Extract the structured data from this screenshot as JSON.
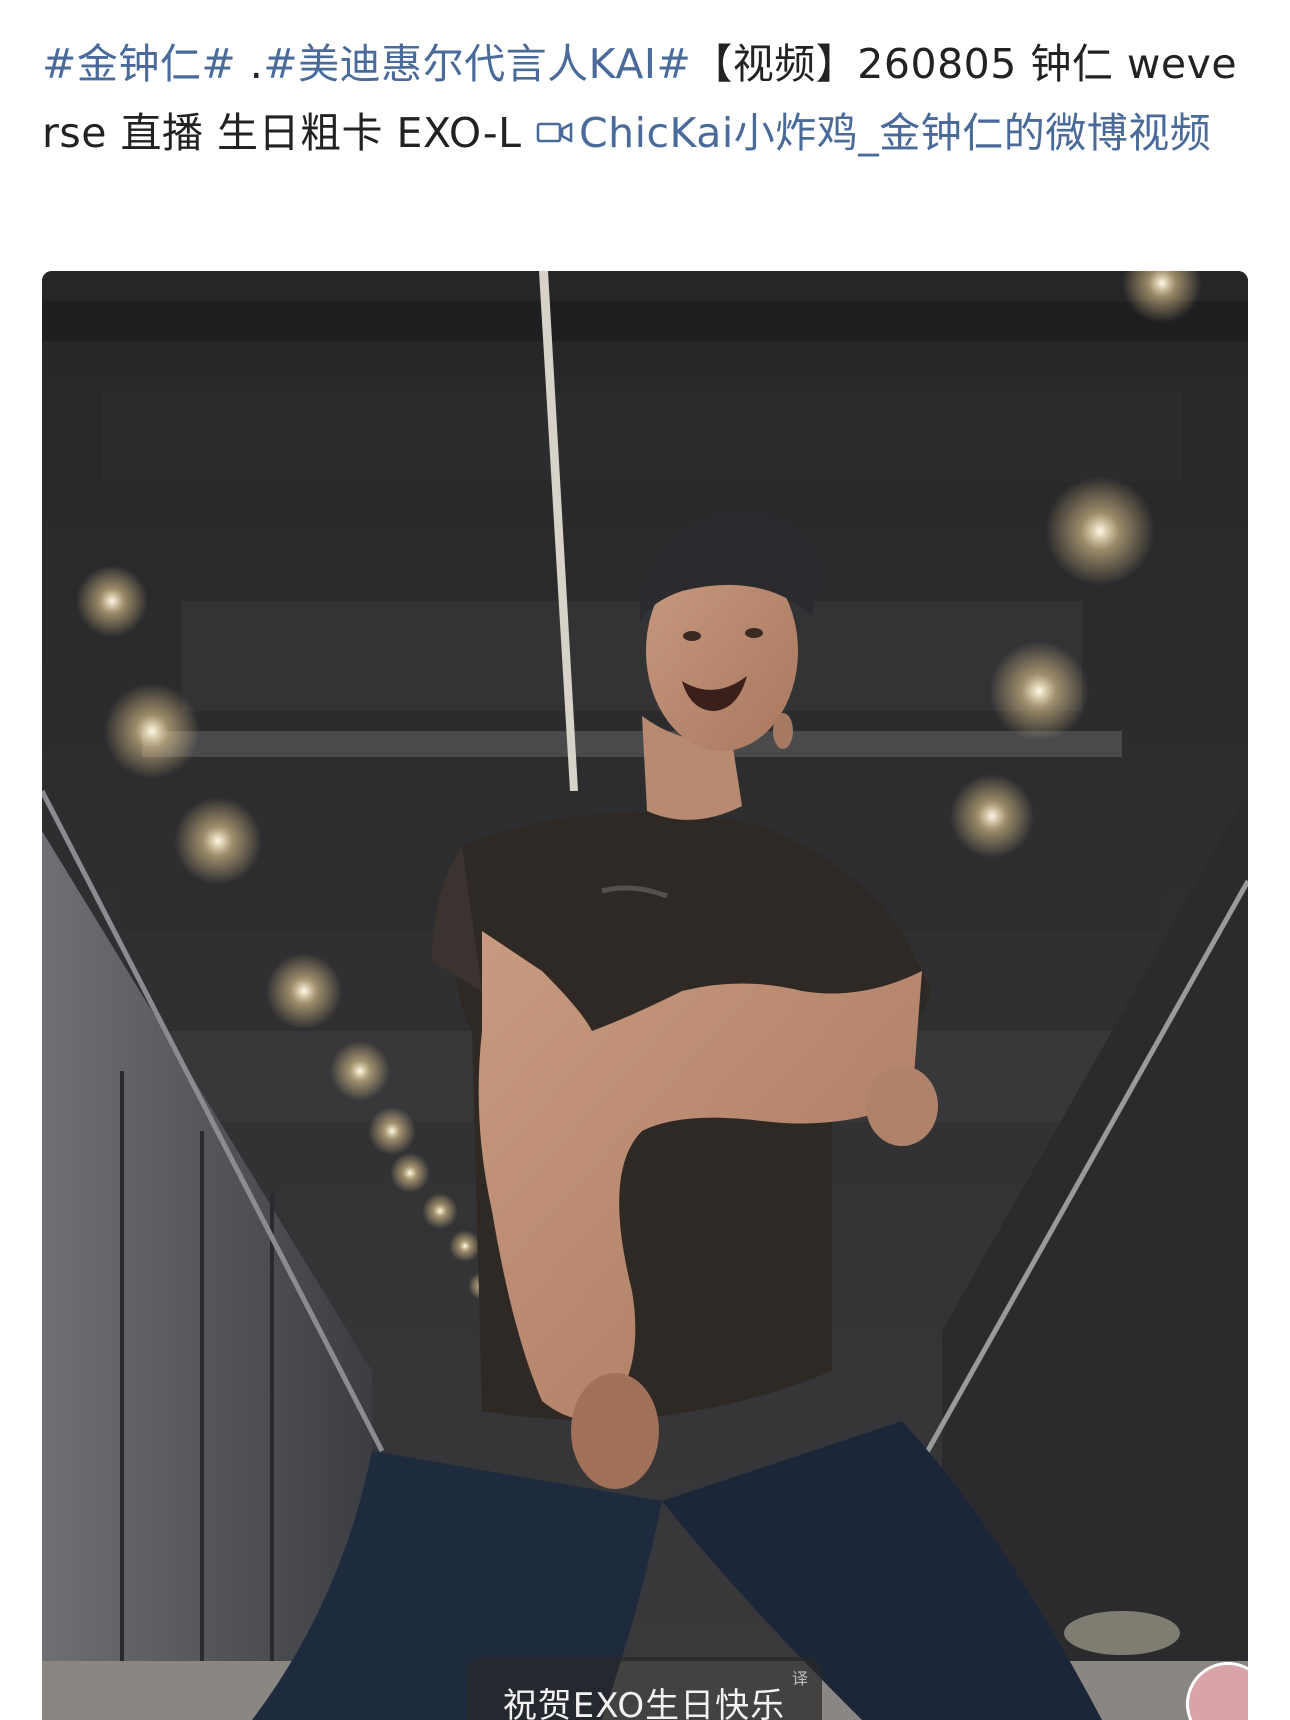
{
  "post": {
    "segments": [
      {
        "text": "#金钟仁#",
        "kind": "link"
      },
      {
        "text": " .",
        "kind": "plain"
      },
      {
        "text": "#美迪惠尔代言人KAI#",
        "kind": "link"
      },
      {
        "text": "【视频】260805 钟仁 weverse 直播 生日粗卡 EXO-L ",
        "kind": "plain"
      }
    ],
    "video_link": "ChicKai小炸鸡_金钟仁的微博视频"
  },
  "video": {
    "subtitle": "祝贺EXO生日快乐",
    "translate_badge": "译"
  },
  "colors": {
    "link": "#4a6b9a",
    "text": "#222222"
  }
}
